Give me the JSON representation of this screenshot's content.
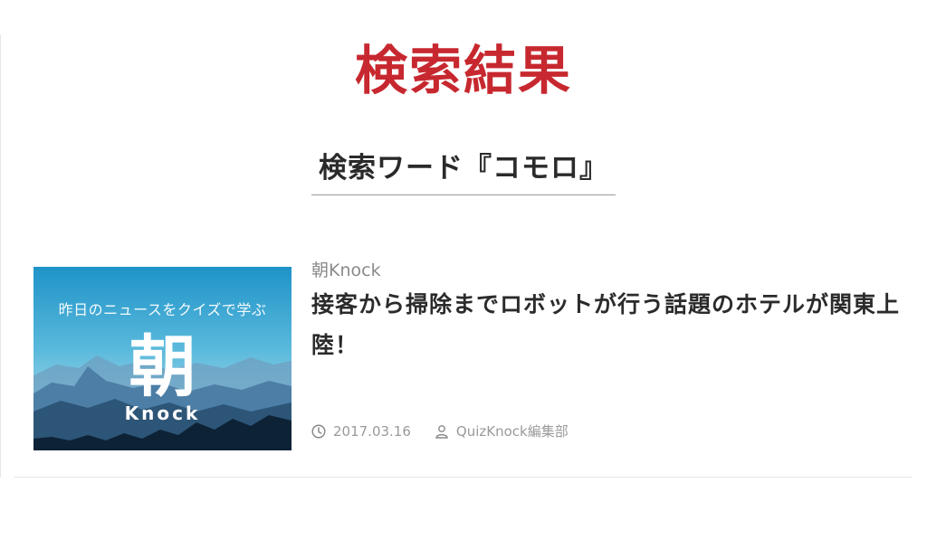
{
  "colors": {
    "title": "#c7282f",
    "text": "#2b2b2b",
    "muted": "#9a9a9a"
  },
  "page": {
    "title": "検索結果",
    "search_term": "検索ワード『コモロ』"
  },
  "results": [
    {
      "thumbnail": {
        "tagline": "昨日のニュースをクイズで学ぶ",
        "kanji": "朝",
        "brand": "Knock"
      },
      "category": "朝Knock",
      "title": "接客から掃除までロボットが行う話題のホテルが関東上陸！",
      "date": "2017.03.16",
      "author": "QuizKnock編集部",
      "date_icon": "clock-icon",
      "author_icon": "user-icon"
    }
  ]
}
